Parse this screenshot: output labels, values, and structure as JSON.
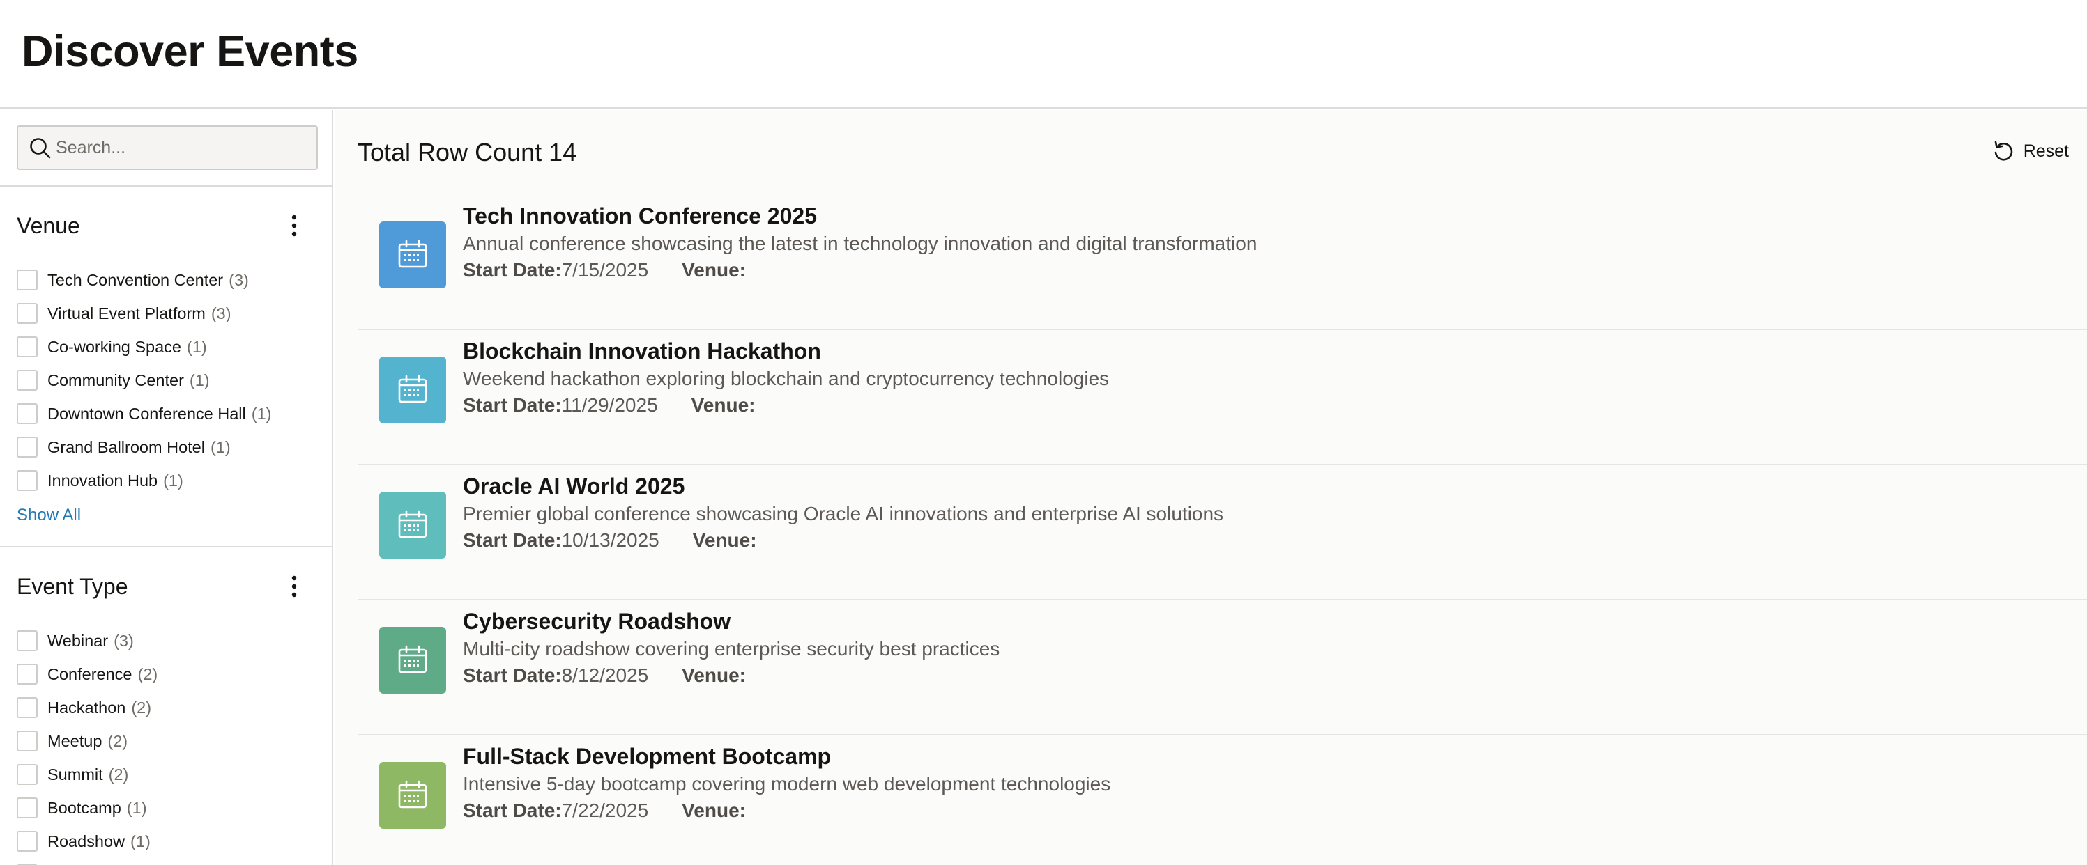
{
  "header": {
    "title": "Discover Events"
  },
  "search": {
    "placeholder": "Search..."
  },
  "facets": [
    {
      "title": "Venue",
      "items": [
        {
          "label": "Tech Convention Center",
          "count": "(3)"
        },
        {
          "label": "Virtual Event Platform",
          "count": "(3)"
        },
        {
          "label": "Co-working Space",
          "count": "(1)"
        },
        {
          "label": "Community Center",
          "count": "(1)"
        },
        {
          "label": "Downtown Conference Hall",
          "count": "(1)"
        },
        {
          "label": "Grand Ballroom Hotel",
          "count": "(1)"
        },
        {
          "label": "Innovation Hub",
          "count": "(1)"
        }
      ],
      "show_all": "Show All"
    },
    {
      "title": "Event Type",
      "items": [
        {
          "label": "Webinar",
          "count": "(3)"
        },
        {
          "label": "Conference",
          "count": "(2)"
        },
        {
          "label": "Hackathon",
          "count": "(2)"
        },
        {
          "label": "Meetup",
          "count": "(2)"
        },
        {
          "label": "Summit",
          "count": "(2)"
        },
        {
          "label": "Bootcamp",
          "count": "(1)"
        },
        {
          "label": "Roadshow",
          "count": "(1)"
        }
      ]
    }
  ],
  "results": {
    "row_count_label": "Total Row Count 14",
    "reset_label": "Reset",
    "start_label": "Start Date:",
    "venue_label": "Venue:",
    "items": [
      {
        "title": "Tech Innovation Conference 2025",
        "description": "Annual conference showcasing the latest in technology innovation and digital transformation",
        "start_date": "7/15/2025",
        "venue": "",
        "color": "#4f9bd9"
      },
      {
        "title": "Blockchain Innovation Hackathon",
        "description": "Weekend hackathon exploring blockchain and cryptocurrency technologies",
        "start_date": "11/29/2025",
        "venue": "",
        "color": "#54b3cf"
      },
      {
        "title": "Oracle AI World 2025",
        "description": "Premier global conference showcasing Oracle AI innovations and enterprise AI solutions",
        "start_date": "10/13/2025",
        "venue": "",
        "color": "#5fbdbb"
      },
      {
        "title": "Cybersecurity Roadshow",
        "description": "Multi-city roadshow covering enterprise security best practices",
        "start_date": "8/12/2025",
        "venue": "",
        "color": "#5fab88"
      },
      {
        "title": "Full-Stack Development Bootcamp",
        "description": "Intensive 5-day bootcamp covering modern web development technologies",
        "start_date": "7/22/2025",
        "venue": "",
        "color": "#8fb864"
      }
    ]
  },
  "icons": {
    "search": "search-icon",
    "kebab": "kebab-menu-icon",
    "reset": "reset-icon",
    "calendar": "calendar-icon"
  }
}
